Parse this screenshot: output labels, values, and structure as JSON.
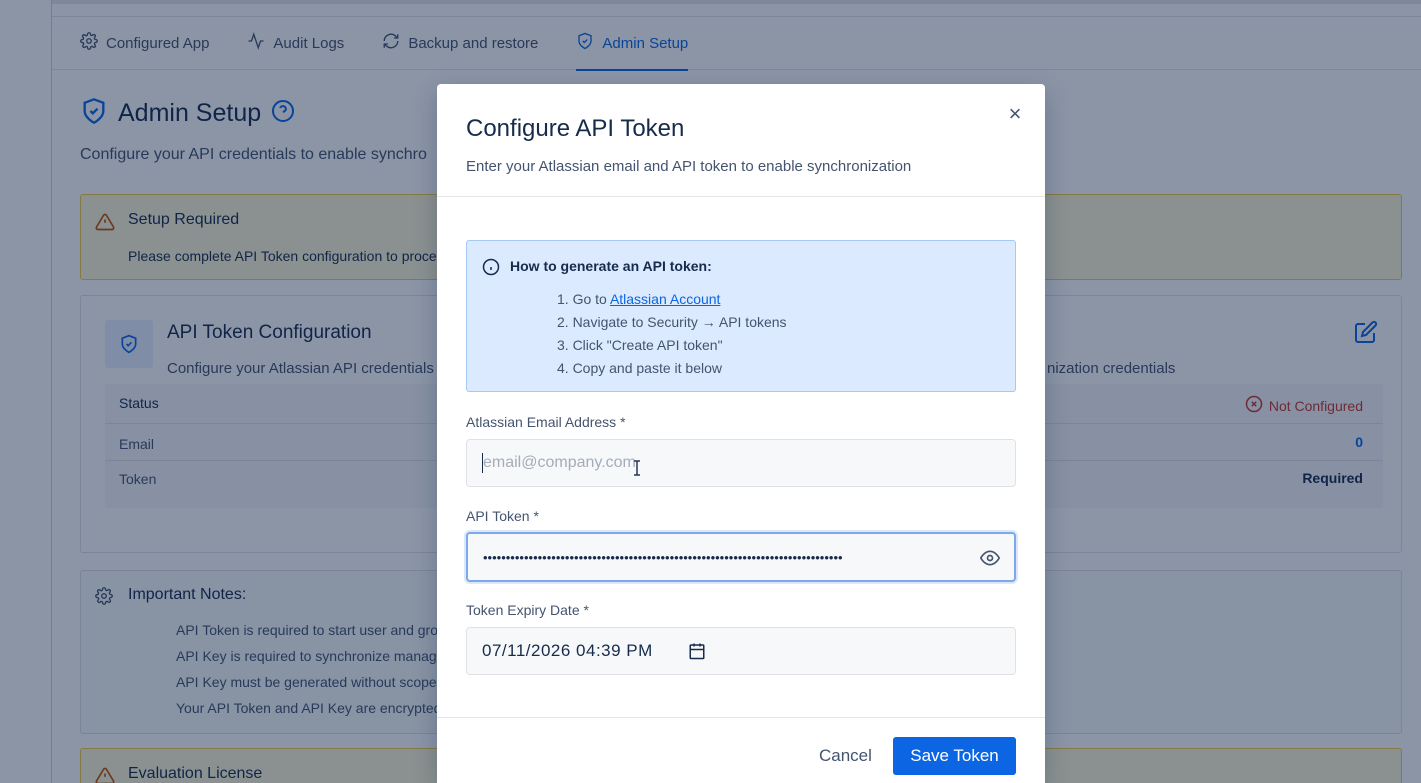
{
  "tabs": [
    {
      "label": "Configured App",
      "icon": "gear-icon"
    },
    {
      "label": "Audit Logs",
      "icon": "activity-icon"
    },
    {
      "label": "Backup and restore",
      "icon": "backup-icon"
    },
    {
      "label": "Admin Setup",
      "icon": "shield-check-icon",
      "active": true
    }
  ],
  "page": {
    "title": "Admin Setup",
    "subtitle": "Configure your API credentials to enable synchro"
  },
  "setup_alert": {
    "title": "Setup Required",
    "text": "Please complete API Token configuration to proce"
  },
  "token_card": {
    "title": "API Token Configuration",
    "description_left": "Configure your Atlassian API credentials",
    "description_right": "nization credentials",
    "rows": [
      {
        "label": "Status",
        "value": "Not Configured"
      },
      {
        "label": "Email",
        "value": "0"
      },
      {
        "label": "Token",
        "value": "Required"
      }
    ]
  },
  "notes": {
    "title": "Important Notes:",
    "items": [
      "API Token is required to start user and gro",
      "API Key is required to synchronize manag",
      "API Key must be generated without scope",
      "Your API Token and API Key are encrypted"
    ]
  },
  "license_alert": {
    "title": "Evaluation License"
  },
  "modal": {
    "title": "Configure API Token",
    "subtitle": "Enter your Atlassian email and API token to enable synchronization",
    "info_title": "How to generate an API token:",
    "steps": [
      {
        "prefix": "1. Go to ",
        "link": "Atlassian Account"
      },
      {
        "prefix": "2. Navigate to Security → API tokens"
      },
      {
        "prefix": "3. Click \"Create API token\""
      },
      {
        "prefix": "4. Copy and paste it below"
      }
    ],
    "email_label": "Atlassian Email Address *",
    "email_placeholder": "email@company.com",
    "email_value": "",
    "token_label": "API Token *",
    "token_value": "•••••••••••••••••••••••••••••••••••••••••••••••••••••••••••••••••••••••••••••••",
    "expiry_label": "Token Expiry Date *",
    "expiry_value": "07/11/2026 04:39 PM",
    "cancel_label": "Cancel",
    "save_label": "Save Token",
    "close_glyph": "×"
  },
  "colors": {
    "accent": "#0c66e4",
    "warning_bg": "#fff7d6",
    "danger": "#c9372c",
    "info_bg": "#dbeafe"
  }
}
